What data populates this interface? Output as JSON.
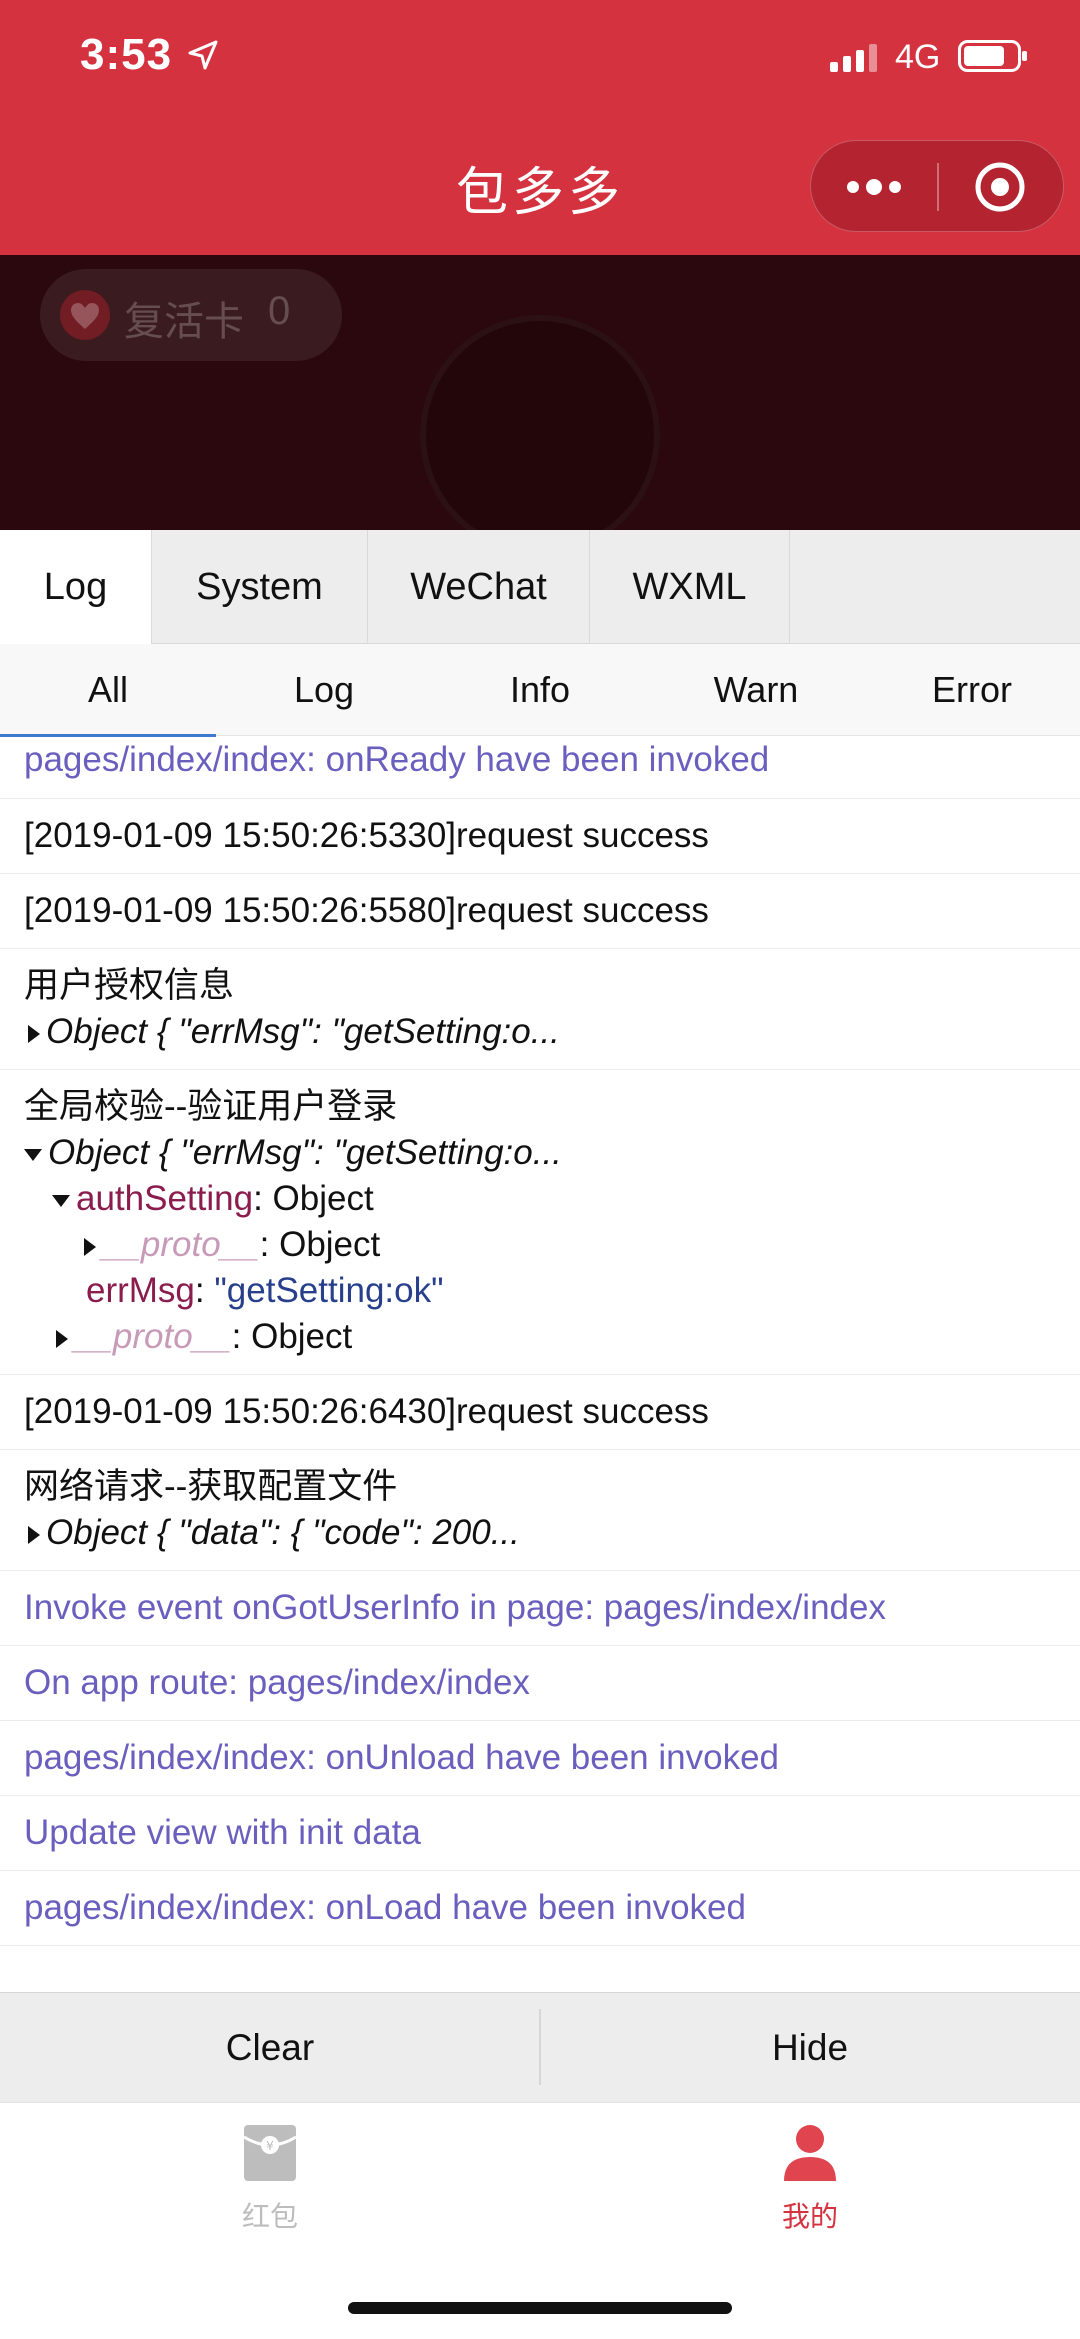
{
  "status_bar": {
    "time": "3:53",
    "network": "4G"
  },
  "nav": {
    "title": "包多多"
  },
  "behind": {
    "revive_label": "复活卡",
    "revive_count": "0"
  },
  "console": {
    "tabs": [
      "Log",
      "System",
      "WeChat",
      "WXML"
    ],
    "subtabs": [
      "All",
      "Log",
      "Info",
      "Warn",
      "Error"
    ],
    "logs": {
      "l0": "pages/index/index: onReady have been invoked",
      "l1": "[2019-01-09 15:50:26:5330]request success",
      "l2": "[2019-01-09 15:50:26:5580]request success",
      "l3_title": "用户授权信息",
      "l3_obj": "Object { \"errMsg\": \"getSetting:o...",
      "l4_title": "全局校验--验证用户登录",
      "l4_obj": "Object { \"errMsg\": \"getSetting:o...",
      "l4_auth_key": "authSetting",
      "l4_auth_val": ": Object",
      "l4_proto_key": "__proto__",
      "l4_proto_val": ": Object",
      "l4_errmsg_key": "errMsg",
      "l4_errmsg_val": "\"getSetting:ok\"",
      "l5": "[2019-01-09 15:50:26:6430]request success",
      "l6_title": "网络请求--获取配置文件",
      "l6_obj": "Object { \"data\": { \"code\": 200...",
      "l7": "Invoke event onGotUserInfo in page: pages/index/index",
      "l8": "On app route: pages/index/index",
      "l9": "pages/index/index: onUnload have been invoked",
      "l10": "Update view with init data",
      "l11": "pages/index/index: onLoad have been invoked"
    },
    "clear_label": "Clear",
    "hide_label": "Hide"
  },
  "tabbar": {
    "items": [
      "红包",
      "我的"
    ],
    "active_color": "#d5323f",
    "inactive_color": "#bdbdbd"
  }
}
